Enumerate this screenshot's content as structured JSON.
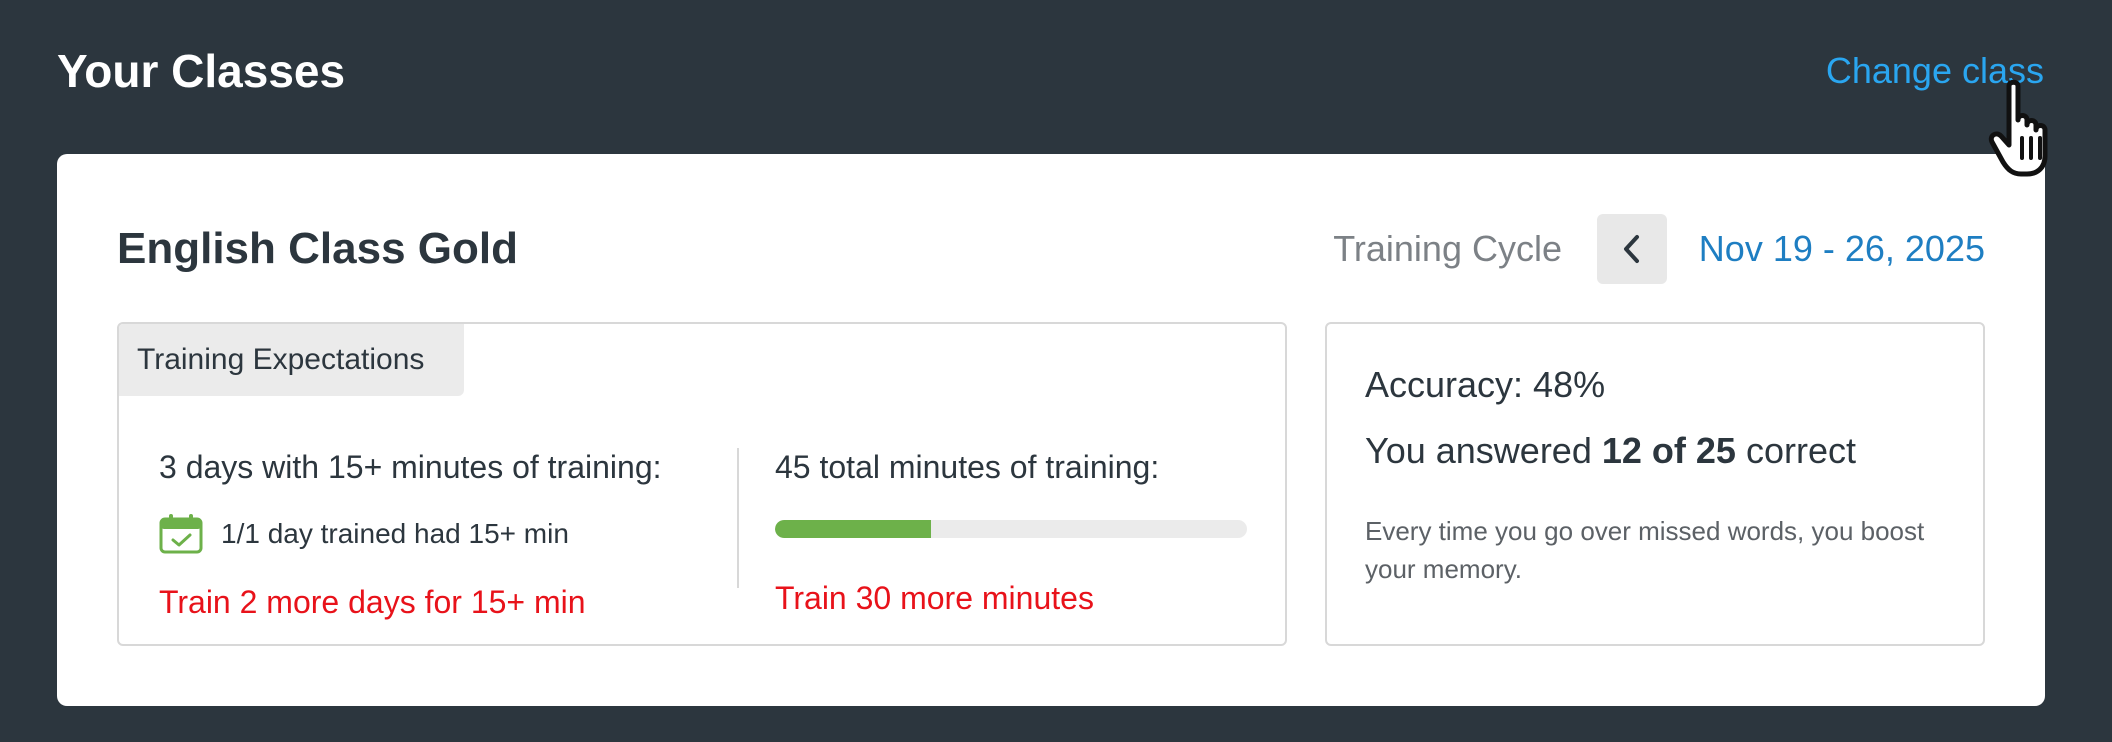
{
  "header": {
    "title": "Your Classes",
    "change_class": "Change class"
  },
  "card": {
    "class_name": "English Class Gold",
    "cycle_label": "Training Cycle",
    "cycle_date": "Nov 19 - 26, 2025"
  },
  "expectations": {
    "tab_label": "Training Expectations",
    "days": {
      "criterion": "3 days with 15+ minutes of training:",
      "status": "1/1 day trained had 15+ min",
      "warning": "Train 2 more days for 15+ min"
    },
    "minutes": {
      "criterion": "45 total minutes of training:",
      "progress_fraction": 0.33,
      "warning": "Train 30 more minutes"
    }
  },
  "accuracy": {
    "title": "Accuracy: 48%",
    "answered_prefix": "You answered ",
    "answered_count": "12 of 25",
    "answered_suffix": " correct",
    "tip": "Every time you go over missed words, you boost your memory."
  },
  "colors": {
    "background": "#2c363e",
    "link": "#2aa6f0",
    "date": "#1e7ec2",
    "warning": "#e8121a",
    "progress": "#6db14a"
  },
  "icons": {
    "calendar": "calendar-check-icon",
    "prev": "chevron-left-icon",
    "cursor": "hand-pointer-icon"
  }
}
